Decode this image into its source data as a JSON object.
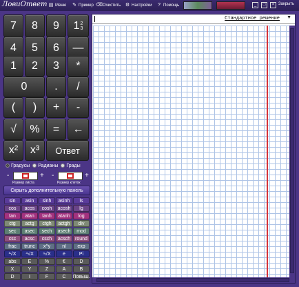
{
  "app": {
    "logo": "ЛовиОтвет",
    "menu": [
      {
        "label": "Меню",
        "icon": "menu-icon"
      },
      {
        "label": "Пример",
        "icon": "pencil-icon"
      },
      {
        "label": "Очистить",
        "icon": "broom-icon"
      },
      {
        "label": "Настройки",
        "icon": "gear-icon"
      },
      {
        "label": "Помощь",
        "icon": "help-icon"
      }
    ],
    "exit_label": "Закрыть",
    "colors": {
      "background": "#4b3586",
      "grid_line": "#aec4e6",
      "margin_line": "#d6333a"
    }
  },
  "keypad": {
    "row1": [
      "7",
      "8",
      "9",
      "1",
      "—"
    ],
    "frac": {
      "num": "2",
      "den": "3"
    },
    "row2": [
      "4",
      "5",
      "6",
      "—"
    ],
    "row3": [
      "1",
      "2",
      "3",
      "*"
    ],
    "row4": [
      "0",
      ".",
      "/"
    ],
    "row5": [
      "(",
      ")",
      "+",
      "-"
    ],
    "row6": [
      "√",
      "%",
      "=",
      "←"
    ],
    "row7": [
      "x²",
      "x³",
      "Ответ"
    ]
  },
  "units": {
    "degrees": "Градусы",
    "radians": "Радианы",
    "grads": "Грады",
    "selected": "Градусы"
  },
  "size": {
    "sheet_label": "Размер листа",
    "cell_label": "Размер клеток",
    "minus": "-",
    "plus": "+"
  },
  "hide_panel_label": "Скрыть дополнительную панель",
  "functions": [
    [
      {
        "l": "sin",
        "c": "#5a3b9a"
      },
      {
        "l": "asin",
        "c": "#5a3b9a"
      },
      {
        "l": "sinh",
        "c": "#5a3b9a"
      },
      {
        "l": "asinh",
        "c": "#5a3b9a"
      },
      {
        "l": "ls",
        "c": "#5a3b9a"
      }
    ],
    [
      {
        "l": "cos",
        "c": "#6a4488"
      },
      {
        "l": "acos",
        "c": "#6a4488"
      },
      {
        "l": "cosh",
        "c": "#6a4488"
      },
      {
        "l": "acosh",
        "c": "#6a4488"
      },
      {
        "l": "lg",
        "c": "#6a4488"
      }
    ],
    [
      {
        "l": "tan",
        "c": "#a3327f"
      },
      {
        "l": "atan",
        "c": "#a3327f"
      },
      {
        "l": "tanh",
        "c": "#a3327f"
      },
      {
        "l": "atanh",
        "c": "#a3327f"
      },
      {
        "l": "log",
        "c": "#a3327f"
      }
    ],
    [
      {
        "l": "ctg",
        "c": "#7f8a76"
      },
      {
        "l": "actg",
        "c": "#7f8a76"
      },
      {
        "l": "ctgh",
        "c": "#7f8a76"
      },
      {
        "l": "actgh",
        "c": "#7f8a76"
      },
      {
        "l": "div",
        "c": "#7f8a76"
      }
    ],
    [
      {
        "l": "sec",
        "c": "#5d7f73"
      },
      {
        "l": "asec",
        "c": "#5d7f73"
      },
      {
        "l": "sech",
        "c": "#5d7f73"
      },
      {
        "l": "asech",
        "c": "#5d7f73"
      },
      {
        "l": "mod",
        "c": "#5d7f73"
      }
    ],
    [
      {
        "l": "csc",
        "c": "#8f4f7f"
      },
      {
        "l": "acsc",
        "c": "#8f4f7f"
      },
      {
        "l": "csch",
        "c": "#8f4f7f"
      },
      {
        "l": "acsch",
        "c": "#8f4f7f"
      },
      {
        "l": "round",
        "c": "#8f4f7f"
      }
    ],
    [
      {
        "l": "frac",
        "c": "#5f6f86"
      },
      {
        "l": "trunc",
        "c": "#5f6f86"
      },
      {
        "l": "x^y",
        "c": "#5f6f86"
      },
      {
        "l": "nl",
        "c": "#5f6f86"
      },
      {
        "l": "exp",
        "c": "#5f6f86"
      }
    ],
    [
      {
        "l": "³√X",
        "c": "#2a2f8a"
      },
      {
        "l": "⁴√X",
        "c": "#2a2f8a"
      },
      {
        "l": "ⁿ√X",
        "c": "#2a2f8a"
      },
      {
        "l": "e",
        "c": "#2a2f8a"
      },
      {
        "l": "Pi",
        "c": "#2a2f8a"
      }
    ],
    [
      {
        "l": "abs",
        "c": "#5a5a5a"
      },
      {
        "l": "E",
        "c": "#5a5a5a"
      },
      {
        "l": "%",
        "c": "#5a5a5a"
      },
      {
        "l": "€",
        "c": "#5a5a5a"
      },
      {
        "l": "D",
        "c": "#5a5a5a"
      }
    ],
    [
      {
        "l": "X",
        "c": "#5a5a5a"
      },
      {
        "l": "Y",
        "c": "#5a5a5a"
      },
      {
        "l": "Z",
        "c": "#5a5a5a"
      },
      {
        "l": "A",
        "c": "#5a5a5a"
      },
      {
        "l": "B",
        "c": "#5a5a5a"
      }
    ],
    [
      {
        "l": "D",
        "c": "#5a5a5a"
      },
      {
        "l": "I",
        "c": "#5a5a5a"
      },
      {
        "l": "F",
        "c": "#5a5a5a"
      },
      {
        "l": "C",
        "c": "#5a5a5a"
      },
      {
        "l": "Повыш.",
        "c": "#5a5a5a"
      }
    ]
  ],
  "solution_mode": {
    "selected": "Стандартное решение"
  }
}
